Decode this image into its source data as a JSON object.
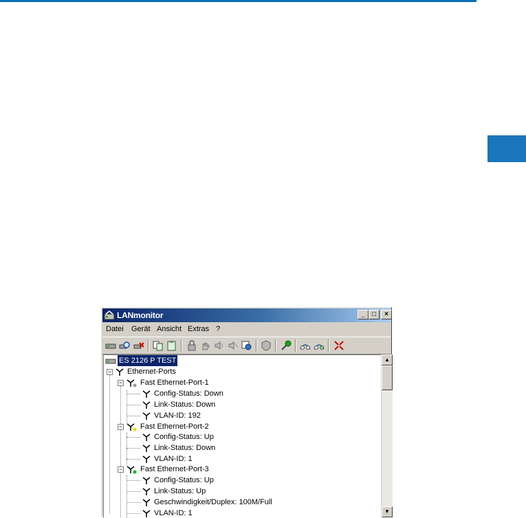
{
  "window": {
    "title": "LANmonitor"
  },
  "title_buttons": {
    "minimize": "_",
    "maximize": "□",
    "close": "×"
  },
  "menu": [
    "Datei",
    "Gerät",
    "Ansicht",
    "Extras",
    "?"
  ],
  "toolbar_icons": [
    "device-icon",
    "search-device-icon",
    "delete-icon",
    "copy-icon",
    "paste-icon",
    "lock-icon",
    "hand-icon",
    "speaker-icon",
    "speaker-off-icon",
    "scan-icon",
    "shield-icon",
    "connect-icon",
    "network-icon",
    "network-refresh-icon",
    "collapse-icon"
  ],
  "tree": {
    "root": "ES 2126 P TEST",
    "group": "Ethernet-Ports",
    "ports": [
      {
        "name": "Fast Ethernet-Port-1",
        "status_color": "#9a9a9a",
        "children": [
          "Config-Status: Down",
          "Link-Status: Down",
          "VLAN-ID: 192"
        ]
      },
      {
        "name": "Fast Ethernet-Port-2",
        "status_color": "#e8e000",
        "children": [
          "Config-Status: Up",
          "Link-Status: Down",
          "VLAN-ID: 1"
        ]
      },
      {
        "name": "Fast Ethernet-Port-3",
        "status_color": "#00c000",
        "children": [
          "Config-Status: Up",
          "Link-Status: Up",
          "Geschwindigkeit/Duplex: 100M/Full",
          "VLAN-ID: 1"
        ]
      }
    ]
  },
  "colors": {
    "accent_blue": "#1b75bb",
    "titlebar_start": "#0a246a",
    "titlebar_end": "#a6caf0"
  }
}
